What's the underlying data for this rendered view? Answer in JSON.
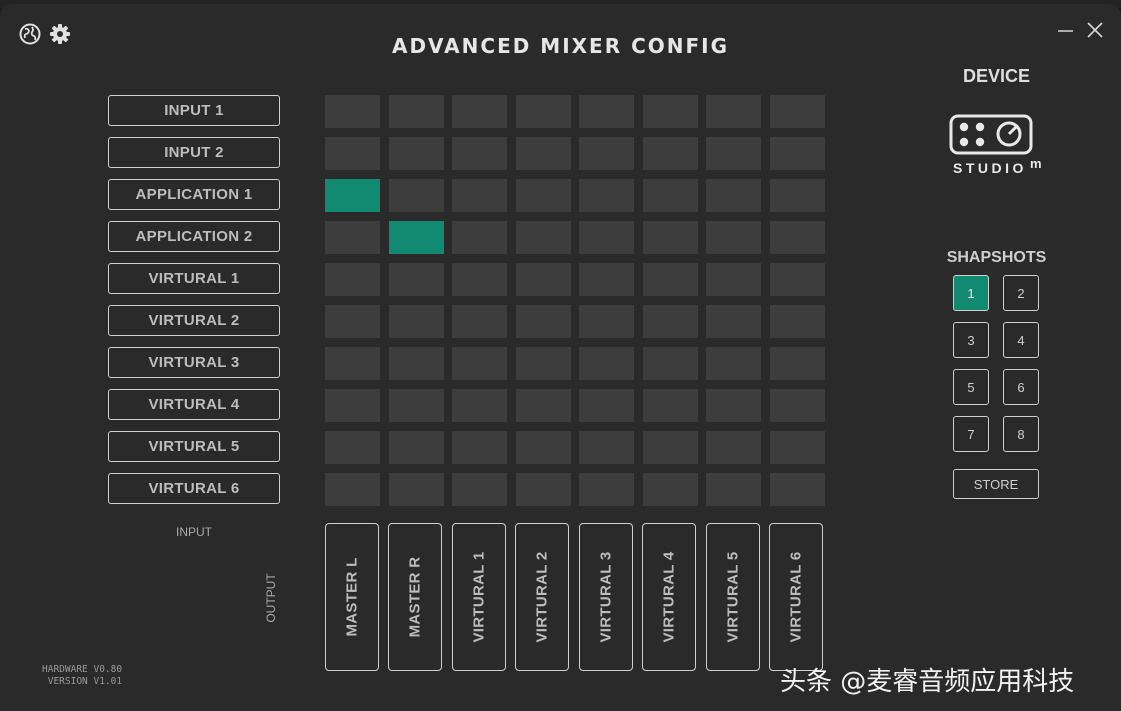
{
  "window": {
    "title": "ADVANCED MIXER CONFIG",
    "top_strip_text": "",
    "accent_color": "#128a72"
  },
  "toolbar": {
    "globe_icon": "globe-icon",
    "settings_icon": "gear-icon"
  },
  "controls": {
    "minimize_icon": "minimize-icon",
    "close_icon": "close-icon"
  },
  "inputs": {
    "items": [
      "INPUT 1",
      "INPUT 2",
      "APPLICATION 1",
      "APPLICATION 2",
      "VIRTURAL 1",
      "VIRTURAL 2",
      "VIRTURAL 3",
      "VIRTURAL 4",
      "VIRTURAL 5",
      "VIRTURAL 6"
    ],
    "label": "INPUT"
  },
  "outputs": {
    "items": [
      "MASTER L",
      "MASTER R",
      "VIRTURAL 1",
      "VIRTURAL 2",
      "VIRTURAL 3",
      "VIRTURAL 4",
      "VIRTURAL 5",
      "VIRTURAL 6"
    ],
    "label": "OUTPUT"
  },
  "matrix": {
    "active": [
      [
        2,
        0
      ],
      [
        3,
        1
      ]
    ]
  },
  "hardware": {
    "hardware_version": "HARDWARE V0.80",
    "software_version": "VERSION V1.01"
  },
  "device": {
    "title": "DEVICE",
    "logo_text": "STUDIO",
    "logo_badge": "m"
  },
  "snapshots": {
    "title": "SHAPSHOTS",
    "items": [
      "1",
      "2",
      "3",
      "4",
      "5",
      "6",
      "7",
      "8"
    ],
    "selected": "1",
    "store_label": "STORE"
  },
  "watermark": {
    "text": "头条 @麦睿音频应用科技"
  }
}
